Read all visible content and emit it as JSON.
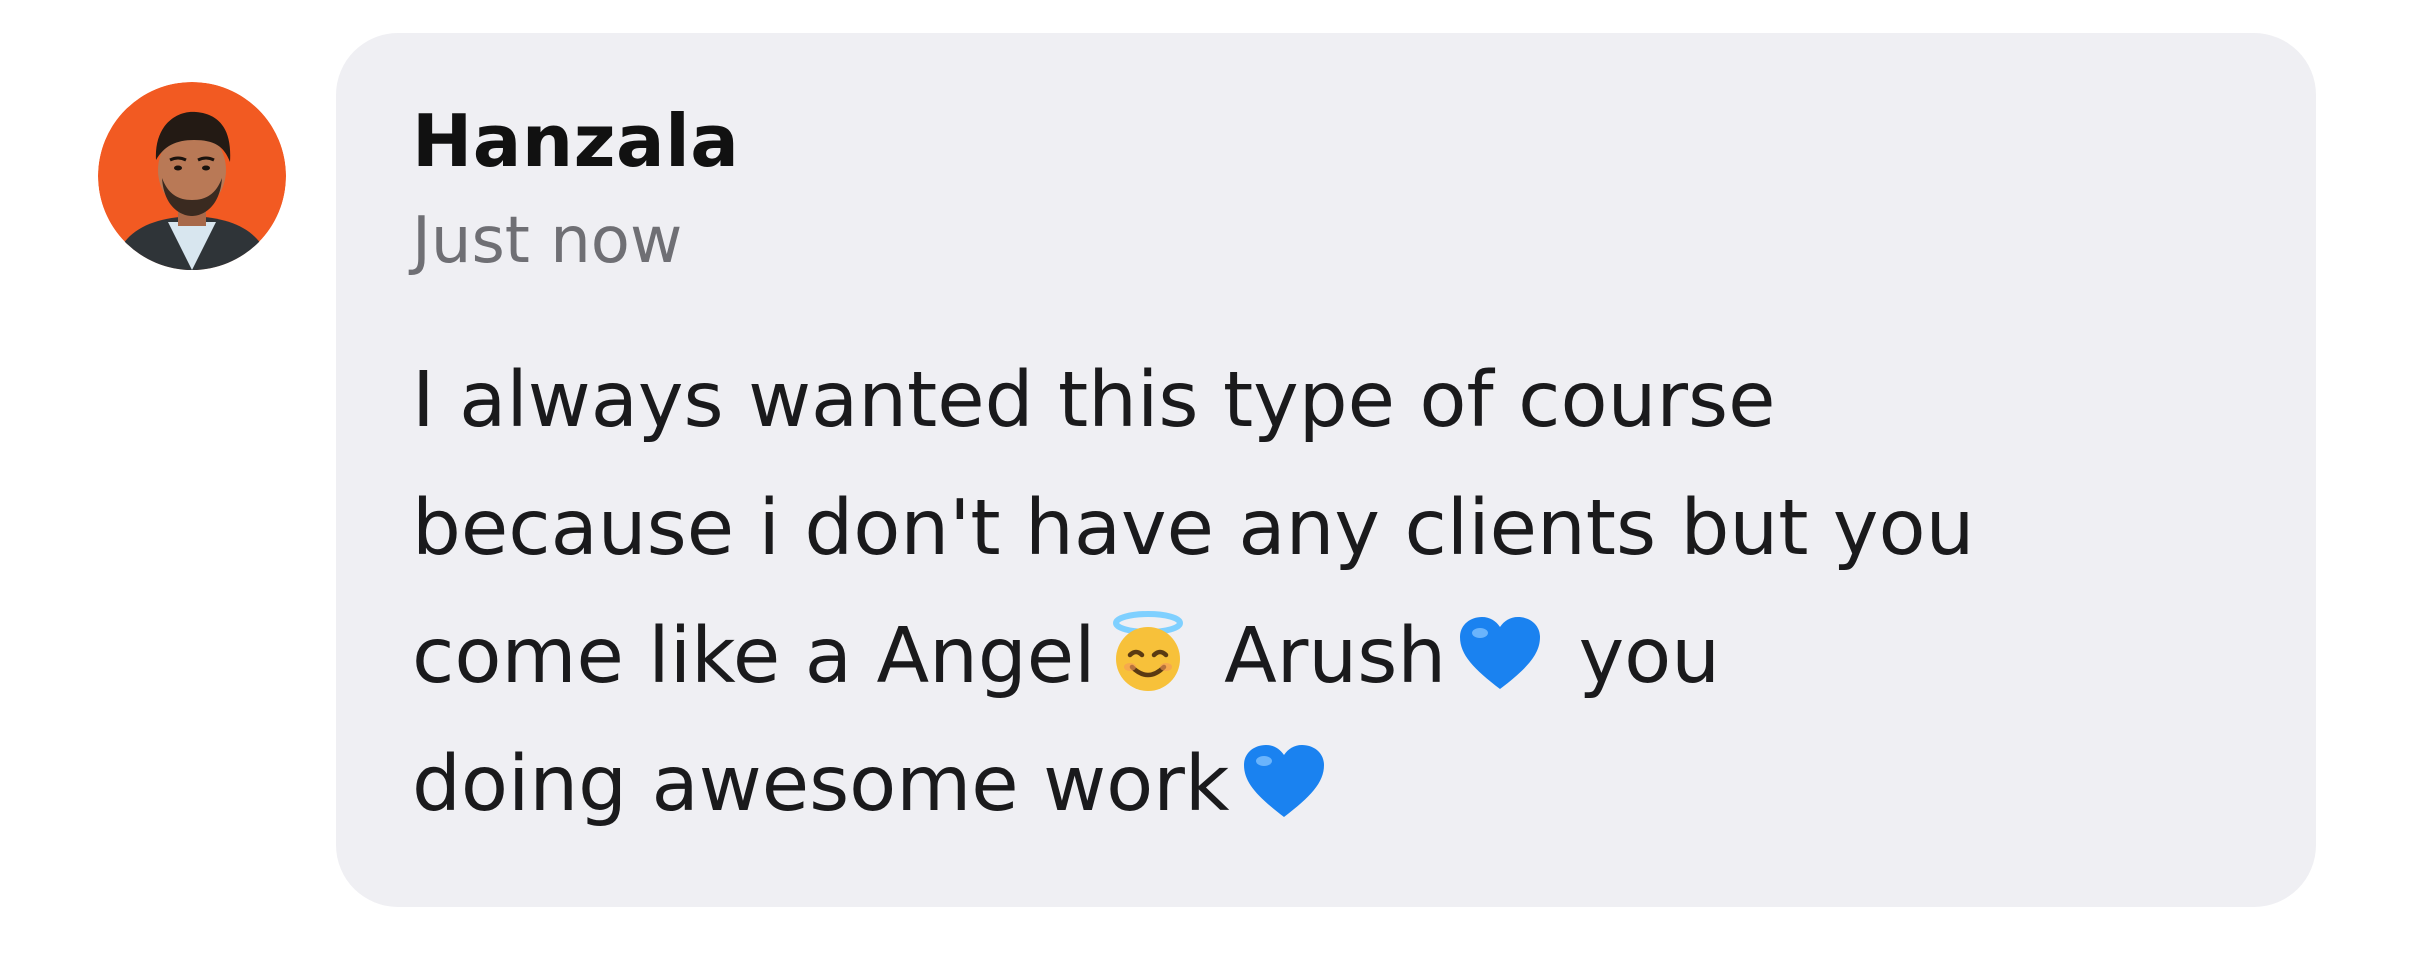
{
  "comment": {
    "author": "Hanzala",
    "timestamp": "Just now",
    "message": {
      "line1": "I always wanted this type of course",
      "line2": "because i don't have any clients but you",
      "line3_part1": "come like a Angel",
      "line3_part2": "Arush",
      "line3_part3": "you",
      "line4_part1": "doing awesome work"
    },
    "emojis": {
      "angel": "smiling-face-with-halo-icon",
      "heart": "blue-heart-icon"
    }
  },
  "colors": {
    "avatar_background": "#f25a22",
    "bubble_background": "#efeff3",
    "heart": "#1a82f0",
    "angel_face": "#f7c13a",
    "halo": "#7fd0ff"
  }
}
